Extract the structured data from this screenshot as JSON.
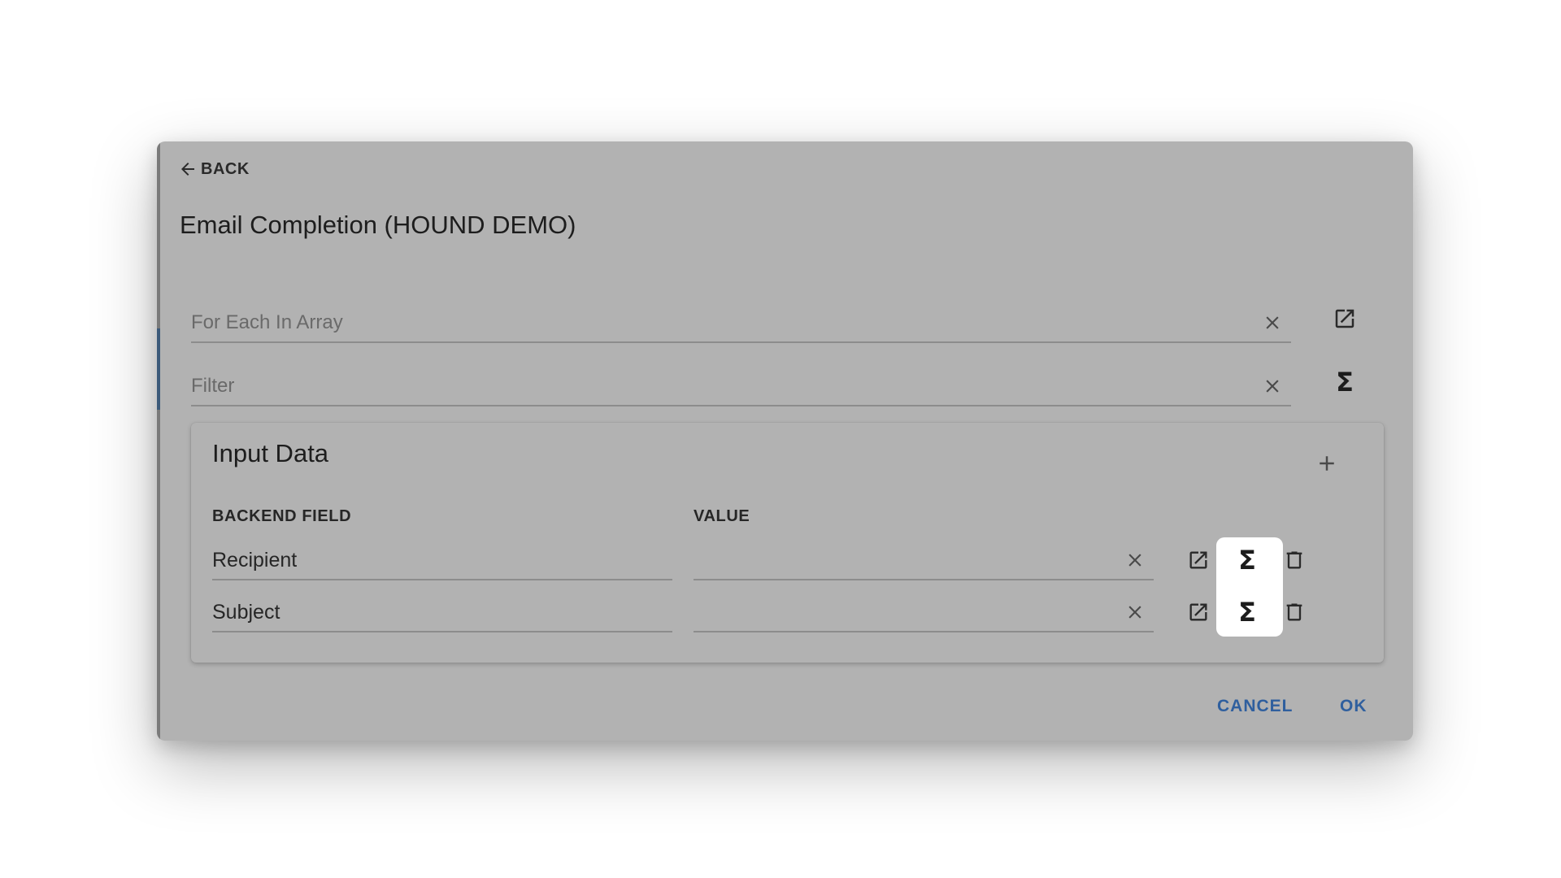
{
  "dialog": {
    "back_label": "BACK",
    "title": "Email Completion (HOUND DEMO)"
  },
  "fields": {
    "for_each": {
      "placeholder": "For Each In Array"
    },
    "filter": {
      "placeholder": "Filter"
    }
  },
  "input_data": {
    "title": "Input Data",
    "columns": [
      "BACKEND FIELD",
      "VALUE"
    ],
    "rows": [
      {
        "backend_field": "Recipient",
        "value": ""
      },
      {
        "backend_field": "Subject",
        "value": ""
      }
    ]
  },
  "footer": {
    "cancel_label": "CANCEL",
    "ok_label": "OK"
  },
  "colors": {
    "overlay": "#b2b2b2",
    "accent": "#2f5f9e",
    "highlight": "#ffffff"
  },
  "icons": [
    "arrow-left-icon",
    "close-icon",
    "open-in-new-icon",
    "sigma-icon",
    "plus-icon",
    "trash-icon"
  ]
}
